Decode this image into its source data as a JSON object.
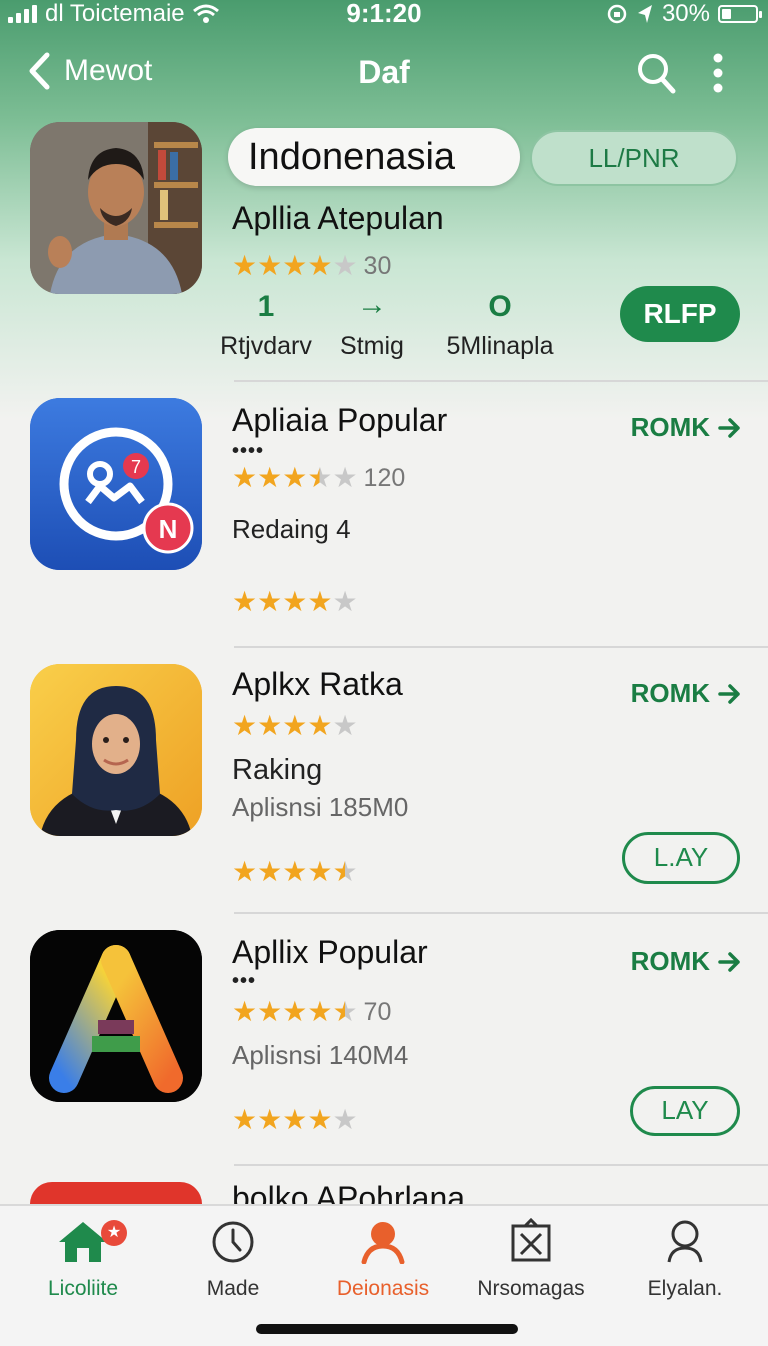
{
  "status_bar": {
    "carrier": "dl Toictemaie",
    "time": "9:1:20",
    "battery": "30%"
  },
  "nav": {
    "back_label": "Mewot",
    "title": "Daf"
  },
  "featured": {
    "tag_primary": "Indonenasia",
    "tag_secondary": "LL/PNR",
    "name": "Apllia Atepulan",
    "rating": 4,
    "rating_count": "30",
    "stats": [
      {
        "value": "1",
        "label": "Rtjvdarv"
      },
      {
        "value": "→",
        "label": "Stmig"
      },
      {
        "value": "O",
        "label": "5Mlinapla"
      }
    ],
    "button_label": "RLFP"
  },
  "apps": [
    {
      "name": "Apliaia Popular",
      "dots": "••••",
      "rating": 3.5,
      "rating_count": "120",
      "subtitle": "Redaing 4",
      "rank_label": "ROMK",
      "bottom_rating": 4
    },
    {
      "name": "Aplkx Ratka",
      "rating": 4,
      "subtitle": "Raking",
      "subtitle2": "Aplisnsi 185M0",
      "rank_label": "ROMK",
      "action_label": "L.AY",
      "bottom_rating": 4.5
    },
    {
      "name": "Apllix Popular",
      "dots": "•••",
      "rating": 4.5,
      "rating_count": "70",
      "subtitle2": "Aplisnsi 140M4",
      "rank_label": "ROMK",
      "action_label": "LAY",
      "bottom_rating": 4
    },
    {
      "name": "bolko APohrlana"
    }
  ],
  "tabs": [
    {
      "label": "Licoliite",
      "badge": "★"
    },
    {
      "label": "Made"
    },
    {
      "label": "Deionasis"
    },
    {
      "label": "Nrsomagas"
    },
    {
      "label": "Elyalan."
    }
  ],
  "colors": {
    "accent_green": "#1f8a4c",
    "header_green": "#4a9c6e",
    "star": "#f2a51f",
    "active_tab_orange": "#e8602c"
  }
}
